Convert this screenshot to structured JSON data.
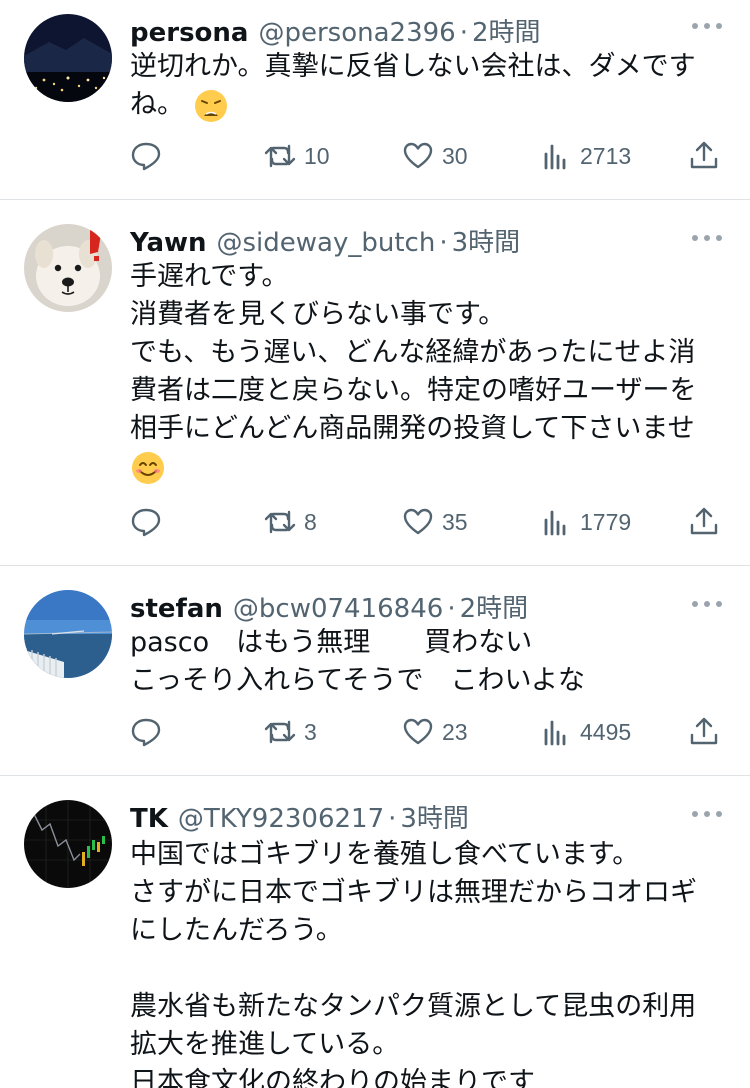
{
  "tweets": [
    {
      "name": "persona",
      "handle": "@persona2396",
      "time": "2時間",
      "lines": [
        "逆切れか。真摯に反省しない会社は、ダメです",
        "ね。"
      ],
      "emoji": "weary-face-emoji",
      "replies": "",
      "retweets": "10",
      "likes": "30",
      "views": "2713",
      "avatar": "night-city-avatar"
    },
    {
      "name": "Yawn",
      "handle": "@sideway_butch",
      "time": "3時間",
      "lines": [
        "手遅れです。",
        "消費者を見くびらない事です。",
        "でも、もう遅い、どんな経緯があったにせよ消",
        "費者は二度と戻らない。特定の嗜好ユーザーを",
        "相手にどんどん商品開発の投資して下さいませ"
      ],
      "emoji": "smiling-face-emoji",
      "replies": "",
      "retweets": "8",
      "likes": "35",
      "views": "1779",
      "avatar": "white-dog-avatar"
    },
    {
      "name": "stefan",
      "handle": "@bcw07416846",
      "time": "2時間",
      "lines": [
        "pasco　はもう無理　　買わない",
        "こっそり入れらてそうで　こわいよな"
      ],
      "replies": "",
      "retweets": "3",
      "likes": "23",
      "views": "4495",
      "avatar": "sea-bridge-avatar"
    },
    {
      "name": "TK",
      "handle": "@TKY92306217",
      "time": "3時間",
      "lines": [
        "中国ではゴキブリを養殖し食べています。",
        "さすがに日本でゴキブリは無理だからコオロギ",
        "にしたんだろう。",
        "",
        "農水省も新たなタンパク質源として昆虫の利用",
        "拡大を推進している。",
        "日本食文化の終わりの始まりです"
      ],
      "avatar": "stock-chart-avatar"
    }
  ],
  "colors": {
    "text": "#0f1419",
    "secondary": "#536471",
    "divider": "#dfe3e6"
  }
}
